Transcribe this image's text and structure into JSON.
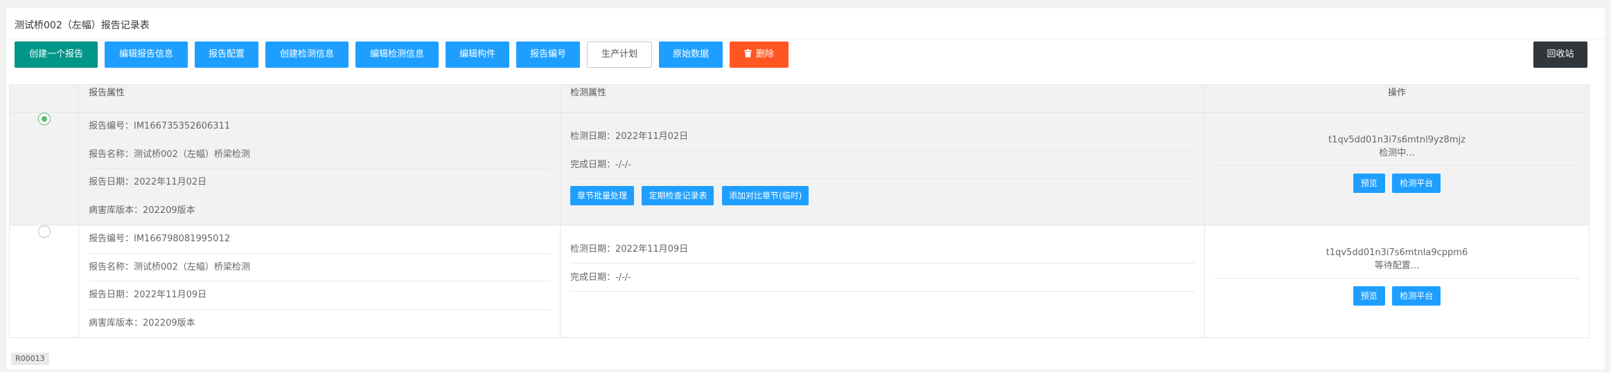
{
  "title": "测试桥002（左幅）报告记录表",
  "toolbar": {
    "create_report": "创建一个报告",
    "edit_report_info": "编辑报告信息",
    "report_config": "报告配置",
    "create_detection_info": "创建检测信息",
    "edit_detection_info": "编辑检测信息",
    "edit_component": "编辑构件",
    "report_number": "报告编号",
    "production_plan": "生产计划",
    "raw_data": "原始数据",
    "delete": "删除",
    "recycle_bin": "回收站"
  },
  "table": {
    "headers": {
      "report_attr": "报告属性",
      "detect_attr": "检测属性",
      "ops": "操作"
    },
    "rows": [
      {
        "selected": true,
        "report_no": "报告编号：IM166735352606311",
        "report_name": "报告名称：测试桥002（左幅）桥梁检测",
        "report_date": "报告日期：2022年11月02日",
        "disease_lib": "病害库版本：202209版本",
        "detect_date": "检测日期：2022年11月02日",
        "finish_date": "完成日期：-/-/-",
        "mini_buttons": [
          "章节批量处理",
          "定期检查记录表",
          "添加对比章节(临时)"
        ],
        "op_code": "t1qv5dd01n3i7s6mtnl9yz8mjz",
        "op_status": "检测中...",
        "preview": "预览",
        "platform": "检测平台"
      },
      {
        "selected": false,
        "report_no": "报告编号：IM166798081995012",
        "report_name": "报告名称：测试桥002（左幅）桥梁检测",
        "report_date": "报告日期：2022年11月09日",
        "disease_lib": "病害库版本：202209版本",
        "detect_date": "检测日期：2022年11月09日",
        "finish_date": "完成日期：-/-/-",
        "op_code": "t1qv5dd01n3i7s6mtnla9cppm6",
        "op_status": "等待配置...",
        "preview": "预览",
        "platform": "检测平台"
      }
    ]
  },
  "footer_tag": "R00013",
  "colors": {
    "green": "#009688",
    "blue": "#1e9fff",
    "red": "#ff5722",
    "dark": "#2f363c",
    "radio_on": "#5fb878"
  }
}
